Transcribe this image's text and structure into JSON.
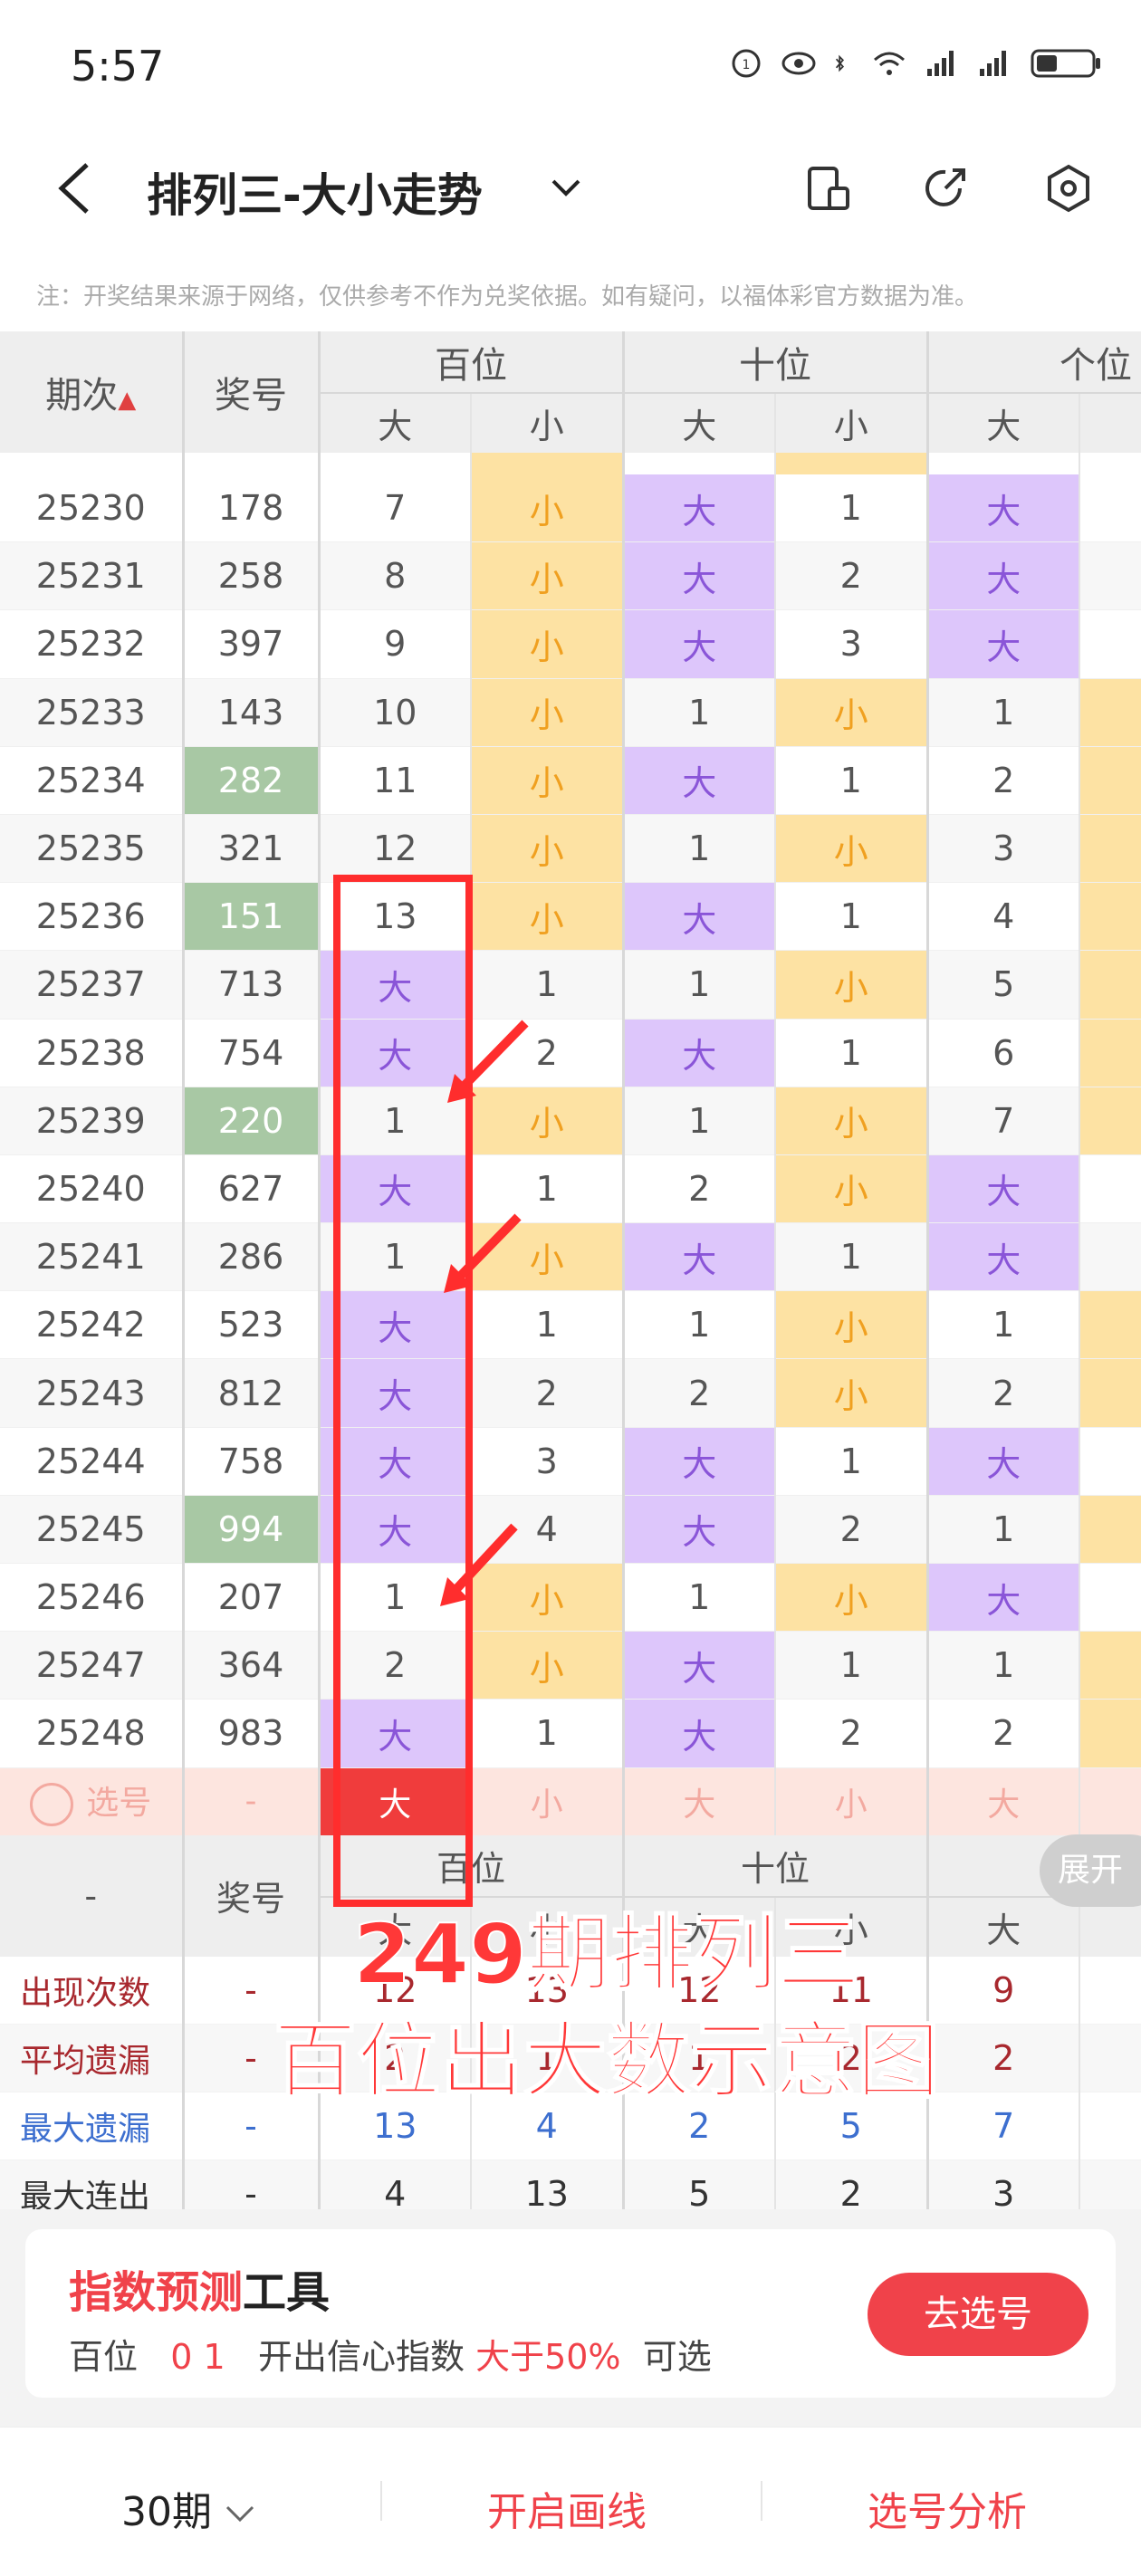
{
  "status_bar": {
    "time": "5:57"
  },
  "title_bar": {
    "title": "排列三-大小走势"
  },
  "notice": "注：开奖结果来源于网络，仅供参考不作为兑奖依据。如有疑问，以福体彩官方数据为准。",
  "header": {
    "issue": "期次",
    "number": "奖号",
    "positions": [
      "百位",
      "十位",
      "个位"
    ],
    "sub": [
      "大",
      "小",
      "大",
      "小",
      "大"
    ]
  },
  "rows": [
    {
      "issue": "25230",
      "num": "178",
      "c": [
        "7",
        "小",
        "大",
        "1",
        "大"
      ],
      "hl": false
    },
    {
      "issue": "25231",
      "num": "258",
      "c": [
        "8",
        "小",
        "大",
        "2",
        "大"
      ],
      "hl": false
    },
    {
      "issue": "25232",
      "num": "397",
      "c": [
        "9",
        "小",
        "大",
        "3",
        "大"
      ],
      "hl": false
    },
    {
      "issue": "25233",
      "num": "143",
      "c": [
        "10",
        "小",
        "1",
        "小",
        "1"
      ],
      "hl": false
    },
    {
      "issue": "25234",
      "num": "282",
      "c": [
        "11",
        "小",
        "大",
        "1",
        "2"
      ],
      "hl": true
    },
    {
      "issue": "25235",
      "num": "321",
      "c": [
        "12",
        "小",
        "1",
        "小",
        "3"
      ],
      "hl": false
    },
    {
      "issue": "25236",
      "num": "151",
      "c": [
        "13",
        "小",
        "大",
        "1",
        "4"
      ],
      "hl": true
    },
    {
      "issue": "25237",
      "num": "713",
      "c": [
        "大",
        "1",
        "1",
        "小",
        "5"
      ],
      "hl": false
    },
    {
      "issue": "25238",
      "num": "754",
      "c": [
        "大",
        "2",
        "大",
        "1",
        "6"
      ],
      "hl": false
    },
    {
      "issue": "25239",
      "num": "220",
      "c": [
        "1",
        "小",
        "1",
        "小",
        "7"
      ],
      "hl": true
    },
    {
      "issue": "25240",
      "num": "627",
      "c": [
        "大",
        "1",
        "2",
        "小",
        "大"
      ],
      "hl": false
    },
    {
      "issue": "25241",
      "num": "286",
      "c": [
        "1",
        "小",
        "大",
        "1",
        "大"
      ],
      "hl": false
    },
    {
      "issue": "25242",
      "num": "523",
      "c": [
        "大",
        "1",
        "1",
        "小",
        "1"
      ],
      "hl": false
    },
    {
      "issue": "25243",
      "num": "812",
      "c": [
        "大",
        "2",
        "2",
        "小",
        "2"
      ],
      "hl": false
    },
    {
      "issue": "25244",
      "num": "758",
      "c": [
        "大",
        "3",
        "大",
        "1",
        "大"
      ],
      "hl": false
    },
    {
      "issue": "25245",
      "num": "994",
      "c": [
        "大",
        "4",
        "大",
        "2",
        "1"
      ],
      "hl": true
    },
    {
      "issue": "25246",
      "num": "207",
      "c": [
        "1",
        "小",
        "1",
        "小",
        "大"
      ],
      "hl": false
    },
    {
      "issue": "25247",
      "num": "364",
      "c": [
        "2",
        "小",
        "大",
        "1",
        "1"
      ],
      "hl": false
    },
    {
      "issue": "25248",
      "num": "983",
      "c": [
        "大",
        "1",
        "大",
        "2",
        "2"
      ],
      "hl": false
    }
  ],
  "select_row": {
    "label": "选号",
    "num": "-",
    "c": [
      "大",
      "小",
      "大",
      "小",
      "大"
    ]
  },
  "footer_header": {
    "issue": "-",
    "number": "奖号",
    "positions": [
      "百位",
      "十位",
      "个位"
    ],
    "sub": [
      "大",
      "小",
      "大",
      "小",
      "大"
    ]
  },
  "stats": [
    {
      "label": "出现次数",
      "num": "-",
      "c": [
        "12",
        "13",
        "12",
        "11",
        "9"
      ],
      "color": "dark-red"
    },
    {
      "label": "平均遗漏",
      "num": "-",
      "c": [
        "2",
        "1",
        "1",
        "2",
        "2"
      ],
      "color": "dark-red"
    },
    {
      "label": "最大遗漏",
      "num": "-",
      "c": [
        "13",
        "4",
        "2",
        "5",
        "7"
      ],
      "color": "blue"
    },
    {
      "label": "最大连出",
      "num": "-",
      "c": [
        "4",
        "13",
        "5",
        "2",
        "3"
      ],
      "color": "dark"
    }
  ],
  "overlay": {
    "line1": "249期排列三",
    "line2": "百位出大数示意图",
    "expand": "展开"
  },
  "tool_card": {
    "title_red": "指数预测",
    "title_black": "工具",
    "pos": "百位",
    "digits": "0 1",
    "mid": "开出信心指数",
    "threshold": "大于50%",
    "end": "可选",
    "button": "去选号"
  },
  "bottom_nav": {
    "period": "30期",
    "draw": "开启画线",
    "analysis": "选号分析"
  }
}
